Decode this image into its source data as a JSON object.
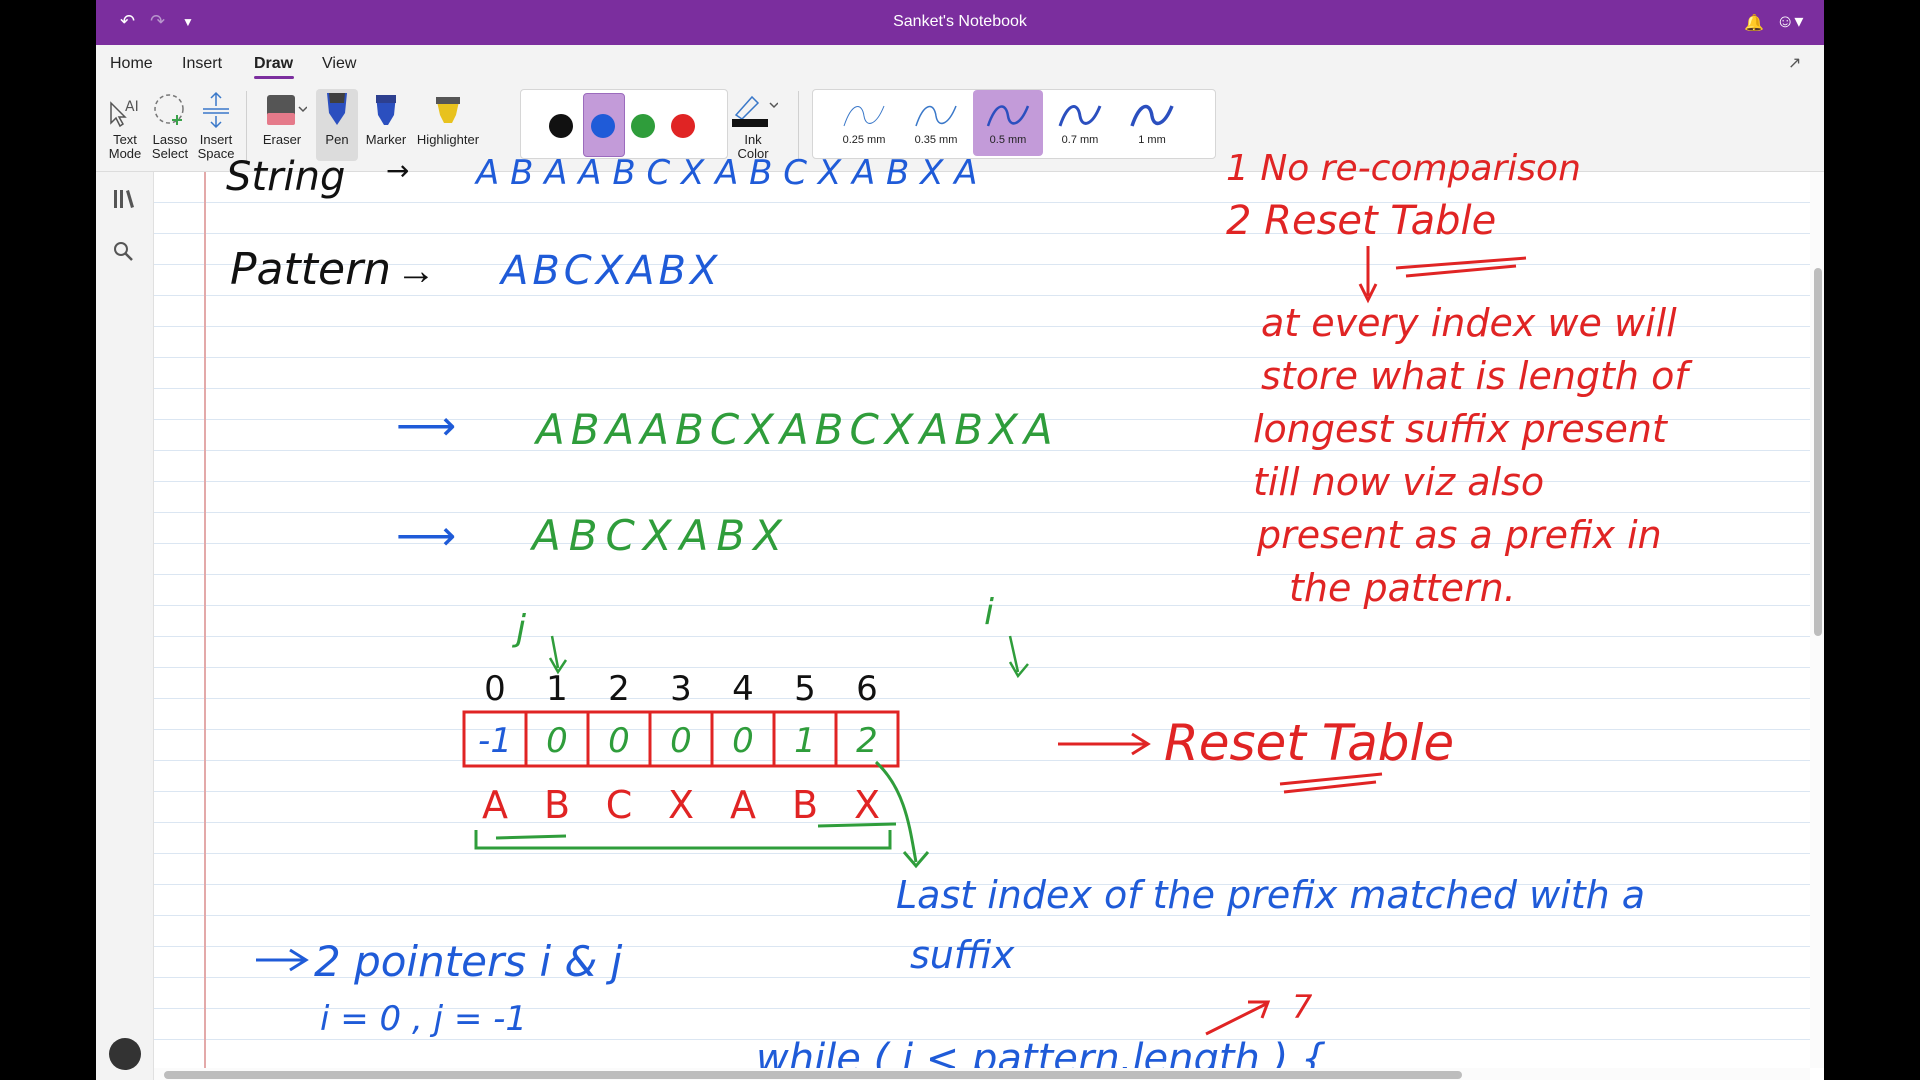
{
  "window": {
    "title": "Sanket's Notebook"
  },
  "menu": {
    "tabs": [
      "Home",
      "Insert",
      "Draw",
      "View"
    ],
    "active": "Draw"
  },
  "ribbon": {
    "text_mode": [
      "Text",
      "Mode"
    ],
    "lasso": [
      "Lasso",
      "Select"
    ],
    "insert_space": [
      "Insert",
      "Space"
    ],
    "eraser": "Eraser",
    "pen": "Pen",
    "marker": "Marker",
    "highlighter": "Highlighter",
    "ink_color": [
      "Ink",
      "Color"
    ],
    "colors": [
      "#111111",
      "#1f5bd8",
      "#2f9d3b",
      "#e02424"
    ],
    "selected_color": "#1f5bd8",
    "thicknesses": [
      "0.25 mm",
      "0.35 mm",
      "0.5 mm",
      "0.7 mm",
      "1 mm"
    ],
    "selected_thickness": "0.5 mm"
  },
  "notes": {
    "string_label": "String",
    "string_value": "A B A A B C X A B C X A B X A",
    "pattern_label": "Pattern",
    "pattern_value": "ABCXABX",
    "green_line": "ABAABCXABCXABXA",
    "blue_line": "ABCXABX",
    "j_marker": "j",
    "i_marker": "i",
    "indices": [
      "0",
      "1",
      "2",
      "3",
      "4",
      "5",
      "6"
    ],
    "table_values": [
      "-1",
      "0",
      "0",
      "0",
      "0",
      "1",
      "2"
    ],
    "table_letters": [
      "A",
      "B",
      "C",
      "X",
      "A",
      "B",
      "X"
    ],
    "reset_table_arrow_label": "Reset Table",
    "last_index_note": "Last index of the prefix matched with a",
    "suffix_word": "suffix",
    "pointers_line": "2 pointers i & j",
    "init_line": "i = 0 , j = -1",
    "seven": "7",
    "while_line": "while ( i < pattern.length ) {",
    "top_right_1": "1 No re-comparison",
    "top_right_2": "2 Reset Table",
    "explanation": [
      "at every index we will",
      "store what is length of",
      "longest suffix present",
      "till now viz also",
      "present as a prefix in",
      "the pattern."
    ]
  }
}
